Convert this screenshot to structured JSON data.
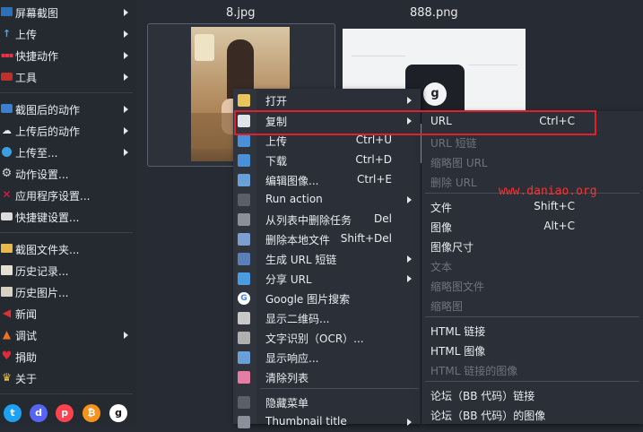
{
  "sidebar": {
    "items": [
      {
        "label": "屏幕截图",
        "icon": "monitor-icon",
        "submenu": true
      },
      {
        "label": "上传",
        "icon": "upload-arrow-icon",
        "submenu": true
      },
      {
        "label": "快捷动作",
        "icon": "grid-dots-icon",
        "submenu": true
      },
      {
        "label": "工具",
        "icon": "toolbox-icon",
        "submenu": true
      },
      {
        "label": "截图后的动作",
        "icon": "screen-action-icon",
        "submenu": true
      },
      {
        "label": "上传后的动作",
        "icon": "cloud-upload-icon",
        "submenu": true
      },
      {
        "label": "上传至...",
        "icon": "globe-upload-icon",
        "submenu": true
      },
      {
        "label": "动作设置...",
        "icon": "gear-icon",
        "submenu": false
      },
      {
        "label": "应用程序设置...",
        "icon": "wrench-screwdriver-icon",
        "submenu": false
      },
      {
        "label": "快捷键设置...",
        "icon": "keyboard-icon",
        "submenu": false
      },
      {
        "label": "截图文件夹...",
        "icon": "folder-icon",
        "submenu": false
      },
      {
        "label": "历史记录...",
        "icon": "history-icon",
        "submenu": false
      },
      {
        "label": "历史图片...",
        "icon": "image-history-icon",
        "submenu": false
      },
      {
        "label": "新闻",
        "icon": "megaphone-icon",
        "submenu": false
      },
      {
        "label": "调试",
        "icon": "traffic-cone-icon",
        "submenu": true
      },
      {
        "label": "捐助",
        "icon": "heart-icon",
        "submenu": false
      },
      {
        "label": "关于",
        "icon": "crown-icon",
        "submenu": false
      }
    ],
    "social": [
      {
        "name": "twitter-icon",
        "glyph": "t",
        "color": "#1da1f2"
      },
      {
        "name": "discord-icon",
        "glyph": "d",
        "color": "#5865f2"
      },
      {
        "name": "patreon-icon",
        "glyph": "p",
        "color": "#ff424d"
      },
      {
        "name": "bitcoin-icon",
        "glyph": "₿",
        "color": "#f7931a"
      },
      {
        "name": "github-icon",
        "glyph": "g",
        "color": "#ffffff"
      }
    ]
  },
  "thumbnails": [
    {
      "title": "8.jpg"
    },
    {
      "title": "888.png"
    }
  ],
  "context_menu": {
    "items": [
      {
        "label": "打开",
        "shortcut": "",
        "submenu": true,
        "icon": "open-file-icon",
        "icon_color": "#e8c45a"
      },
      {
        "label": "复制",
        "shortcut": "",
        "submenu": true,
        "icon": "copy-icon",
        "icon_color": "#dfe3ea"
      },
      {
        "label": "上传",
        "shortcut": "Ctrl+U",
        "submenu": false,
        "icon": "upload-icon",
        "icon_color": "#4a90d9"
      },
      {
        "label": "下载",
        "shortcut": "Ctrl+D",
        "submenu": false,
        "icon": "download-icon",
        "icon_color": "#4a90d9"
      },
      {
        "label": "编辑图像...",
        "shortcut": "Ctrl+E",
        "submenu": false,
        "icon": "edit-image-icon",
        "icon_color": "#6aa0d8"
      },
      {
        "label": "Run action",
        "shortcut": "",
        "submenu": true,
        "icon": "terminal-icon",
        "icon_color": "#5a5f68"
      },
      {
        "label": "从列表中删除任务",
        "shortcut": "Del",
        "submenu": false,
        "icon": "remove-task-icon",
        "icon_color": "#8a8f99"
      },
      {
        "label": "删除本地文件",
        "shortcut": "Shift+Del",
        "submenu": false,
        "icon": "delete-file-icon",
        "icon_color": "#7b9fd0"
      },
      {
        "label": "生成 URL 短链",
        "shortcut": "",
        "submenu": true,
        "icon": "shorten-url-icon",
        "icon_color": "#5b7fb8"
      },
      {
        "label": "分享 URL",
        "shortcut": "",
        "submenu": true,
        "icon": "share-icon",
        "icon_color": "#4a9be0"
      },
      {
        "label": "Google 图片搜索",
        "shortcut": "",
        "submenu": false,
        "icon": "google-icon",
        "icon_color": "#ffffff"
      },
      {
        "label": "显示二维码...",
        "shortcut": "",
        "submenu": false,
        "icon": "qr-code-icon",
        "icon_color": "#c8c8c8"
      },
      {
        "label": "文字识别（OCR）...",
        "shortcut": "",
        "submenu": false,
        "icon": "ocr-icon",
        "icon_color": "#b0b0b0"
      },
      {
        "label": "显示响应...",
        "shortcut": "",
        "submenu": false,
        "icon": "response-icon",
        "icon_color": "#6aa0d8"
      },
      {
        "label": "清除列表",
        "shortcut": "",
        "submenu": false,
        "icon": "eraser-icon",
        "icon_color": "#e47ca4"
      },
      {
        "label": "隐藏菜单",
        "shortcut": "",
        "submenu": false,
        "icon": "hide-menu-icon",
        "icon_color": "#5a5f68"
      },
      {
        "label": "Thumbnail title",
        "shortcut": "",
        "submenu": true,
        "icon": "thumbnail-title-icon",
        "icon_color": "#8a8f99"
      }
    ]
  },
  "copy_submenu": {
    "items": [
      {
        "label": "URL",
        "shortcut": "Ctrl+C",
        "disabled": false
      },
      {
        "label": "URL 短链",
        "shortcut": "",
        "disabled": true
      },
      {
        "label": "缩略图 URL",
        "shortcut": "",
        "disabled": true
      },
      {
        "label": "删除 URL",
        "shortcut": "",
        "disabled": true
      },
      {
        "label": "文件",
        "shortcut": "Shift+C",
        "disabled": false
      },
      {
        "label": "图像",
        "shortcut": "Alt+C",
        "disabled": false
      },
      {
        "label": "图像尺寸",
        "shortcut": "",
        "disabled": false
      },
      {
        "label": "文本",
        "shortcut": "",
        "disabled": true
      },
      {
        "label": "缩略图文件",
        "shortcut": "",
        "disabled": true
      },
      {
        "label": "缩略图",
        "shortcut": "",
        "disabled": true
      },
      {
        "label": "HTML 链接",
        "shortcut": "",
        "disabled": false
      },
      {
        "label": "HTML 图像",
        "shortcut": "",
        "disabled": false
      },
      {
        "label": "HTML 链接的图像",
        "shortcut": "",
        "disabled": true
      },
      {
        "label": "论坛（BB 代码）链接",
        "shortcut": "",
        "disabled": false
      },
      {
        "label": "论坛（BB 代码）的图像",
        "shortcut": "",
        "disabled": false
      }
    ]
  },
  "watermark": {
    "text": "www.daniao.org",
    "color": "#ff3030"
  },
  "colors": {
    "highlight_border": "#e0202a",
    "background": "#272b33",
    "menu": "#2b3038"
  }
}
